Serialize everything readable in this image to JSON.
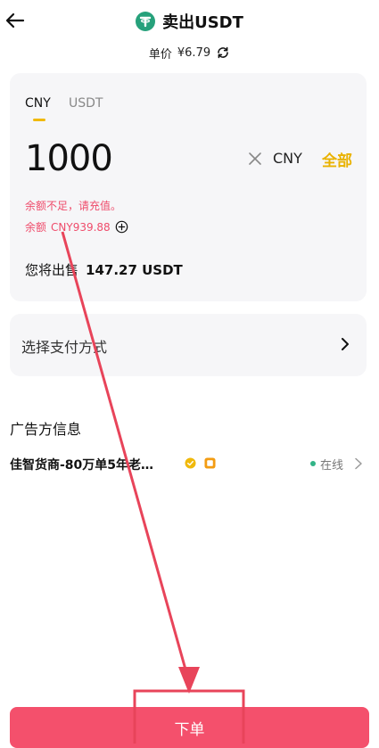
{
  "header": {
    "title": "卖出USDT",
    "price_label": "单价",
    "price_value": "¥6.79"
  },
  "amount_card": {
    "tabs": [
      {
        "label": "CNY",
        "active": true
      },
      {
        "label": "USDT",
        "active": false
      }
    ],
    "amount_value": "1000",
    "currency": "CNY",
    "all_label": "全部",
    "warning": "余额不足，请充值。",
    "balance_label": "余额",
    "balance_value": "CNY939.88",
    "receive_label": "您将出售",
    "receive_value": "147.27 USDT"
  },
  "payment": {
    "label": "选择支付方式"
  },
  "advertiser": {
    "section_title": "广告方信息",
    "name": "佳智货商-80万单5年老…",
    "status": "在线"
  },
  "submit": {
    "label": "下单"
  },
  "colors": {
    "accent": "#f4506c",
    "gold": "#e9b200",
    "warning": "#ef4c6b",
    "online": "#32b487",
    "tether": "#26a17b",
    "annotation": "#e8445a"
  },
  "icons": [
    "back-arrow-icon",
    "tether-logo-icon",
    "refresh-icon",
    "clear-icon",
    "add-circle-icon",
    "chevron-right-icon",
    "verified-badge-icon",
    "merchant-badge-icon"
  ]
}
